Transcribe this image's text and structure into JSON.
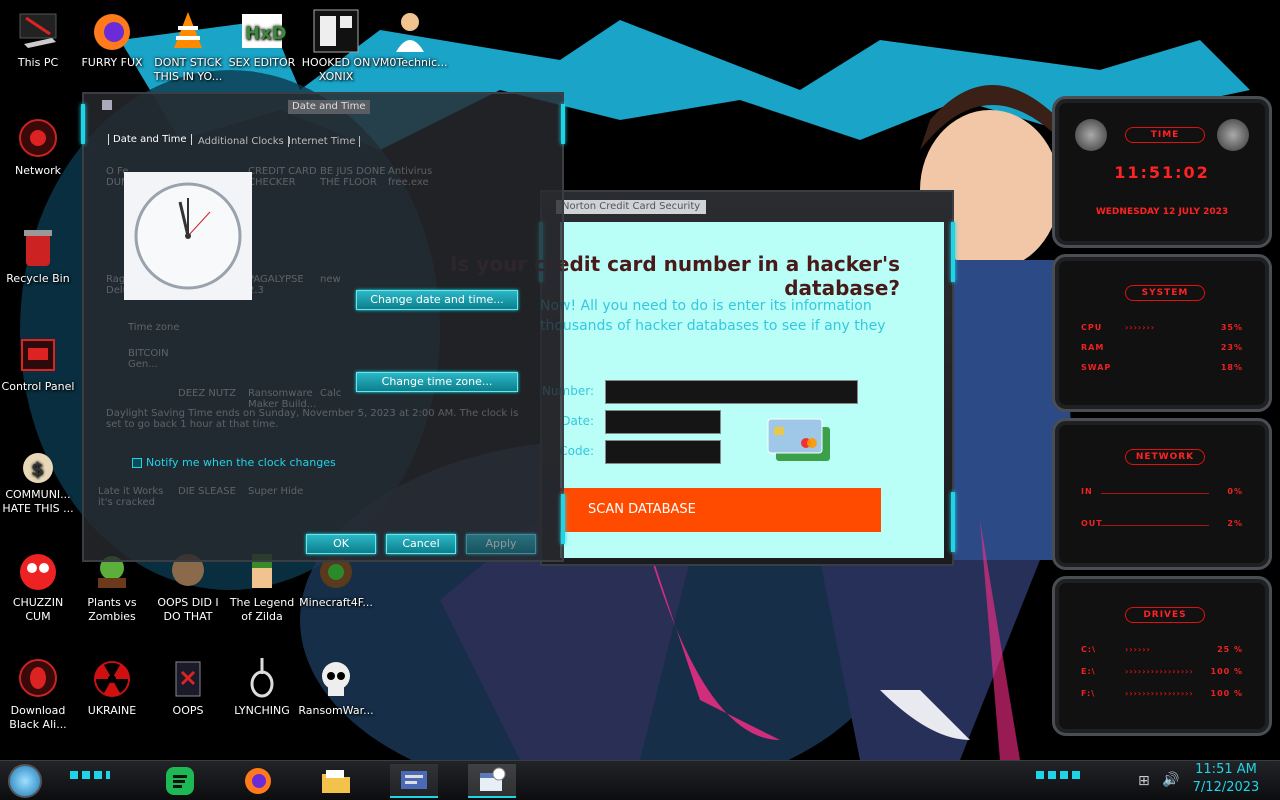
{
  "desktop_icons": [
    {
      "label": "This PC",
      "icon": "this-pc-icon"
    },
    {
      "label": "FURRY FUX",
      "icon": "firefox-icon"
    },
    {
      "label": "DONT STICK THIS IN YO...",
      "icon": "vlc-icon"
    },
    {
      "label": "SEX EDITOR",
      "icon": "hxd-editor-icon"
    },
    {
      "label": "HOOKED ON XONIX",
      "icon": "xonix-game-icon"
    },
    {
      "label": "VM0Technic...",
      "icon": "doctor-icon"
    },
    {
      "label": "Network",
      "icon": "network-icon"
    },
    {
      "label": "Recycle Bin",
      "icon": "recycle-bin-icon"
    },
    {
      "label": "Control Panel",
      "icon": "control-panel-icon"
    },
    {
      "label": "COMMUNI... HATE THIS ...",
      "icon": "money-bag-icon"
    },
    {
      "label": "CHUZZIN CUM",
      "icon": "chuzzle-icon"
    },
    {
      "label": "Plants vs Zombies",
      "icon": "plants-vs-zombies-icon"
    },
    {
      "label": "OOPS DID I DO THAT",
      "icon": "oops-did-i-icon"
    },
    {
      "label": "The Legend of Zilda",
      "icon": "zelda-icon"
    },
    {
      "label": "Minecraft4F...",
      "icon": "minecraft-icon"
    },
    {
      "label": "Download Black Ali...",
      "icon": "alien-icon"
    },
    {
      "label": "UKRAINE",
      "icon": "radiation-icon"
    },
    {
      "label": "OOPS",
      "icon": "oops-icon"
    },
    {
      "label": "LYNCHING",
      "icon": "noose-icon"
    },
    {
      "label": "RansomWar...",
      "icon": "skull-icon"
    }
  ],
  "datetime_dialog": {
    "title": "Date and Time",
    "tabs": [
      "Date and Time",
      "Additional Clocks",
      "Internet Time"
    ],
    "change_date_button": "Change date and time...",
    "change_zone_button": "Change time zone...",
    "notify_label": "Notify me when the clock changes",
    "ok_button": "OK",
    "cancel_button": "Cancel",
    "apply_button": "Apply"
  },
  "ghost_window": {
    "items": [
      "O Fe... DUMBASS",
      "CREDIT CARD CHECKER",
      "BE JUS DONE THE FLOOR",
      "Antivirus free.exe",
      "Raggle Deluxe",
      "PAGALYPSE 2.3",
      "new",
      "BITCOIN Gen...",
      "DEEZ NUTZ",
      "Ransomware Maker Build...",
      "Calc",
      "DIE SLEASE",
      "Super Hide",
      "Late it Works it's cracked"
    ],
    "note": "Daylight Saving Time ends on Sunday, November 5, 2023 at 2:00 AM. The clock is set to go back 1 hour at that time.",
    "field_label": "Time zone"
  },
  "scan_window": {
    "title": "Norton Credit Card Security",
    "heading": "Is your credit card number in a hacker's database?",
    "intro_line1": "Now! All you need to do is enter its information",
    "intro_line2": "thousands of hacker databases to see if any they",
    "field_number_label": "Number:",
    "field_date_label": "Date:",
    "field_code_label": "Code:",
    "scan_button": "SCAN DATABASE",
    "card_icon": "credit-cards-icon"
  },
  "gadgets": {
    "time_title": "TIME",
    "time_value": "11:51:02",
    "date_value": "WEDNESDAY 12 JULY 2023",
    "system_title": "SYSTEM",
    "cpu_label": "CPU",
    "cpu_value": "35%",
    "ram_label": "RAM",
    "ram_value": "23%",
    "swap_label": "SWAP",
    "swap_value": "18%",
    "network_title": "NETWORK",
    "in_label": "IN",
    "in_value": "0%",
    "out_label": "OUT",
    "out_value": "2%",
    "drives_title": "DRIVES",
    "drive_c_label": "C:\\",
    "drive_c_value": "25 %",
    "drive_e_label": "E:\\",
    "drive_e_value": "100 %",
    "drive_f_label": "F:\\",
    "drive_f_value": "100 %"
  },
  "taskbar": {
    "apps": [
      "spotify-icon",
      "firefox-icon",
      "file-explorer-icon",
      "control-panel-icon",
      "date-time-icon"
    ],
    "clock_time": "11:51 AM",
    "clock_date": "7/12/2023"
  },
  "colors": {
    "neon_cyan": "#20d4e8",
    "scan_orange": "#ff4b00",
    "gadget_red": "#e52222",
    "page_cyan": "#b9fff7"
  }
}
